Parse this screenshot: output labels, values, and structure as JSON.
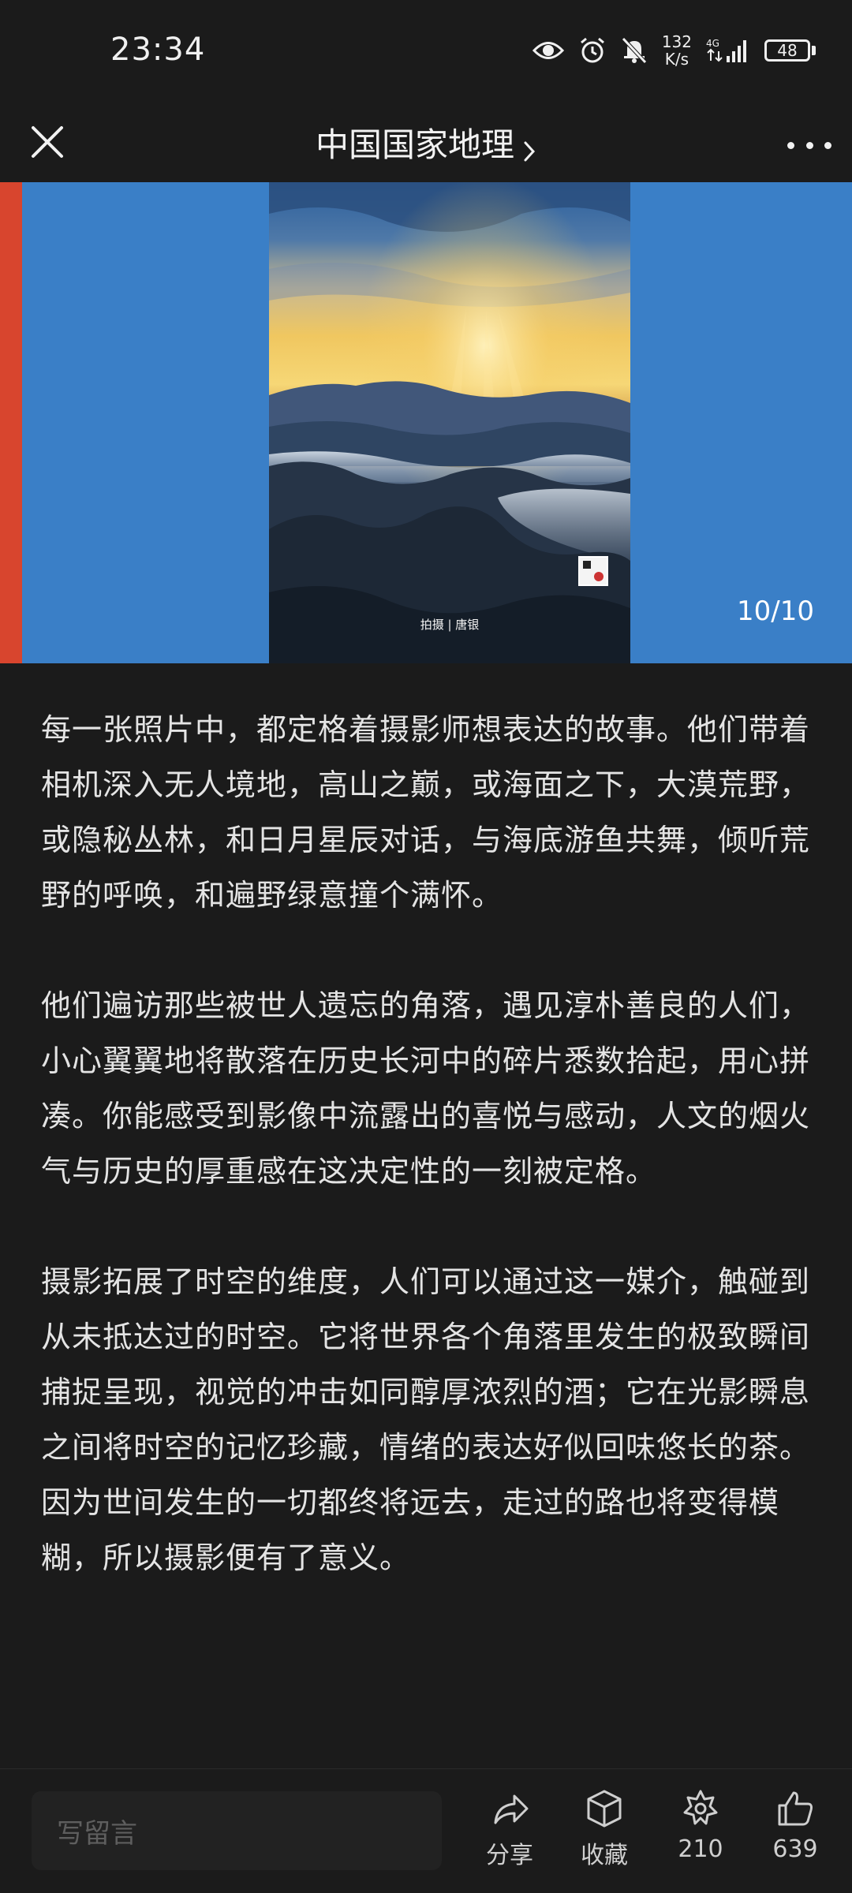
{
  "status_bar": {
    "time": "23:34",
    "network_speed_value": "132",
    "network_speed_unit": "K/s",
    "network_type": "4G",
    "battery_level": "48",
    "icons": [
      "eye-icon",
      "alarm-icon",
      "mute-bell-icon",
      "signal-icon",
      "battery-icon"
    ]
  },
  "header": {
    "title": "中国国家地理",
    "close_icon": "close-icon",
    "more_icon": "more-dots-icon"
  },
  "gallery": {
    "counter": "10/10",
    "photo_credit": "拍摄 | 唐银",
    "colors": {
      "background": "#3a7fc7",
      "previous_slide": "#d8452e"
    }
  },
  "article": {
    "paragraphs": [
      "每一张照片中，都定格着摄影师想表达的故事。他们带着相机深入无人境地，高山之巅，或海面之下，大漠荒野，或隐秘丛林，和日月星辰对话，与海底游鱼共舞，倾听荒野的呼唤，和遍野绿意撞个满怀。",
      "他们遍访那些被世人遗忘的角落，遇见淳朴善良的人们，小心翼翼地将散落在历史长河中的碎片悉数拾起，用心拼凑。你能感受到影像中流露出的喜悦与感动，人文的烟火气与历史的厚重感在这决定性的一刻被定格。",
      "摄影拓展了时空的维度，人们可以通过这一媒介，触碰到从未抵达过的时空。它将世界各个角落里发生的极致瞬间捕捉呈现，视觉的冲击如同醇厚浓烈的酒；它在光影瞬息之间将时空的记忆珍藏，情绪的表达好似回味悠长的茶。因为世间发生的一切都终将远去，走过的路也将变得模糊，所以摄影便有了意义。"
    ]
  },
  "bottom_bar": {
    "comment_placeholder": "写留言",
    "share_label": "分享",
    "collect_label": "收藏",
    "star_count": "210",
    "like_count": "639"
  }
}
